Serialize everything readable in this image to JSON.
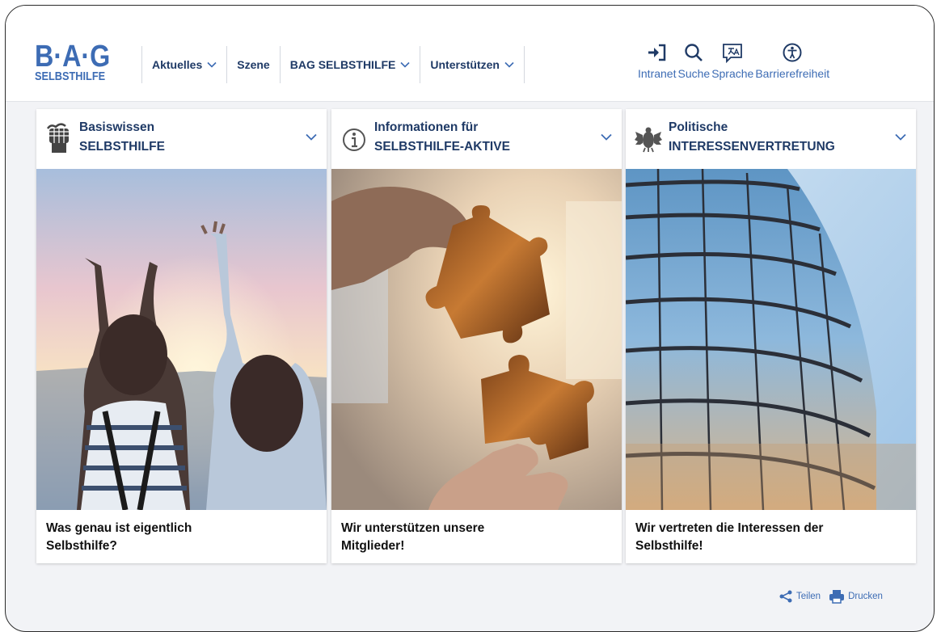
{
  "logo": {
    "top": "B·A·G",
    "bottom": "SELBSTHILFE"
  },
  "nav": [
    {
      "label": "Aktuelles",
      "has_dropdown": true
    },
    {
      "label": "Szene",
      "has_dropdown": false
    },
    {
      "label": "BAG SELBSTHILFE",
      "has_dropdown": true
    },
    {
      "label": "Unterstützen",
      "has_dropdown": true
    }
  ],
  "tools": [
    {
      "label": "Intranet",
      "icon": "login-icon"
    },
    {
      "label": "Suche",
      "icon": "search-icon"
    },
    {
      "label": "Sprache",
      "icon": "translate-icon"
    },
    {
      "label": "Barrierefreiheit",
      "icon": "accessibility-icon"
    }
  ],
  "cards": [
    {
      "title_line1": "Basiswissen",
      "title_line2": "SELBSTHILFE",
      "icon": "fist-icon",
      "caption_line1": "Was genau ist eigentlich",
      "caption_line2": "Selbsthilfe?"
    },
    {
      "title_line1": "Informationen für",
      "title_line2": "SELBSTHILFE-AKTIVE",
      "icon": "info-icon",
      "caption_line1": "Wir unterstützen unsere",
      "caption_line2": "Mitglieder!"
    },
    {
      "title_line1": "Politische",
      "title_line2": "INTERESSENVERTRETUNG",
      "icon": "federal-eagle-icon",
      "caption_line1": "Wir vertreten die Interessen der",
      "caption_line2": "Selbsthilfe!"
    }
  ],
  "footer": {
    "share_label": "Teilen",
    "print_label": "Drucken"
  },
  "colors": {
    "brand_blue": "#3d6cb4",
    "nav_dark": "#1f3a66"
  }
}
